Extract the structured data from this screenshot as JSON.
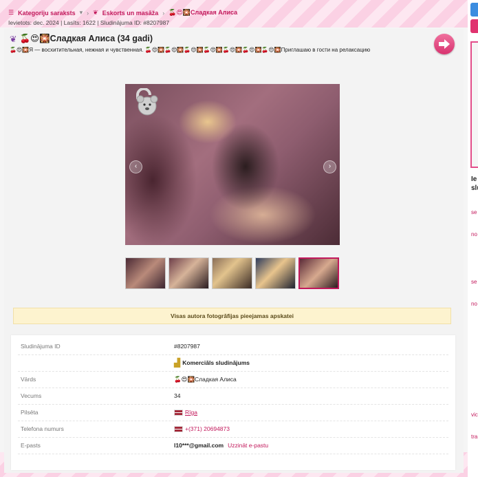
{
  "breadcrumb": {
    "categories_label": "Kategoriju saraksts",
    "category_label": "Eskorts un masāža",
    "current_label": "🍒😍🎇Сладкая Алиса"
  },
  "meta": {
    "line": "Ievietots: dec. 2024 | Lasīts: 1622 | Sludinājuma ID: #8207987"
  },
  "listing": {
    "title": "🍒😍🎇Сладкая Алиса (34 gadi)",
    "description": "🍒😍🎇Я — восхитительная, нежная и чувственная. 🍒😍🎇🍒😍🎇🍒😍🎇🍒😍🎇🍒😍🎇🍒😍🎇🍒😍🎇Приглашаю в гости на релаксацию"
  },
  "gallery": {
    "thumbnail_count": 5,
    "active_index": 4
  },
  "notice": {
    "text": "Visas autora fotogrāfijas pieejamas apskatei"
  },
  "details": {
    "rows": [
      {
        "label": "Sludinājuma ID",
        "value": "#8207987"
      },
      {
        "label": "",
        "value": "Komerciāls sludinājums"
      },
      {
        "label": "Vārds",
        "value": "🍒😍🎇Сладкая Алиса"
      },
      {
        "label": "Vecums",
        "value": "34"
      },
      {
        "label": "Pilsēta",
        "value": "Rīga"
      },
      {
        "label": "Telefona numurs",
        "value": "+(371) 20694873"
      },
      {
        "label": "E-pasts",
        "value": "l10***@gmail.com",
        "link": "Uzzināt e-pastu"
      }
    ]
  },
  "sidebar": {
    "heading_1": "Ie",
    "heading_2": "slu",
    "items": [
      "se",
      "no",
      "se",
      "no",
      "vic",
      "tra"
    ]
  },
  "colors": {
    "accent": "#c2185b",
    "notice_bg": "#fdf3cf"
  }
}
